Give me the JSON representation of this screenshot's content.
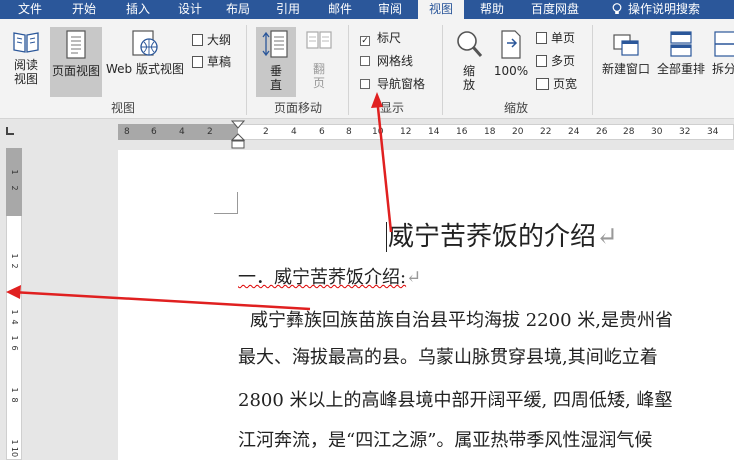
{
  "tabs": [
    "文件",
    "开始",
    "插入",
    "设计",
    "布局",
    "引用",
    "邮件",
    "审阅",
    "视图",
    "帮助",
    "百度网盘",
    "操作说明搜索"
  ],
  "active_tab": "视图",
  "ribbon": {
    "views": {
      "read_mode": "阅读\n视图",
      "print_layout": "页面视图",
      "web_layout": "Web 版式视图",
      "outline": "大纲",
      "draft": "草稿",
      "group_label": "视图"
    },
    "page_movement": {
      "vertical": "垂\n直",
      "side_to_side": "翻\n页",
      "group_label": "页面移动"
    },
    "show": {
      "ruler": "标尺",
      "gridlines": "网格线",
      "nav_pane": "导航窗格",
      "ruler_checked": true,
      "gridlines_checked": false,
      "nav_pane_checked": false,
      "group_label": "显示"
    },
    "zoom": {
      "zoom": "缩\n放",
      "hundred": "100%",
      "one_page": "单页",
      "multi_page": "多页",
      "page_width": "页宽",
      "group_label": "缩放"
    },
    "window": {
      "new_window": "新建窗口",
      "arrange_all": "全部重排",
      "split": "拆分"
    }
  },
  "ruler": {
    "h_left": [
      "8",
      "6",
      "4",
      "2"
    ],
    "h_right": [
      "2",
      "4",
      "6",
      "8",
      "10",
      "12",
      "14",
      "16",
      "18",
      "20",
      "22",
      "24",
      "26",
      "28",
      "30",
      "32",
      "34"
    ],
    "v_marks": [
      "1",
      "2",
      "1",
      "2",
      "1",
      "4",
      "1",
      "6",
      "1",
      "8",
      "1",
      "10"
    ]
  },
  "document": {
    "title": "威宁苦荞饭的介绍",
    "heading": "一．威宁苦荞饭介绍:",
    "paragraph_lines": [
      "威宁彝族回族苗族自治县平均海拔  2200  米,是贵州省",
      "最大、海拔最高的县。乌蒙山脉贯穿县境,其间屹立着",
      "2800 米以上的高峰县境中部开阔平缓, 四周低矮, 峰壑",
      "江河奔流，是“四江之源”。属亚热带季风性湿润气候"
    ],
    "paragraph_mark": "↵"
  },
  "colors": {
    "tabbar": "#2b579a",
    "ribbon": "#f3f3f3",
    "annotation_arrow": "#e02020"
  }
}
